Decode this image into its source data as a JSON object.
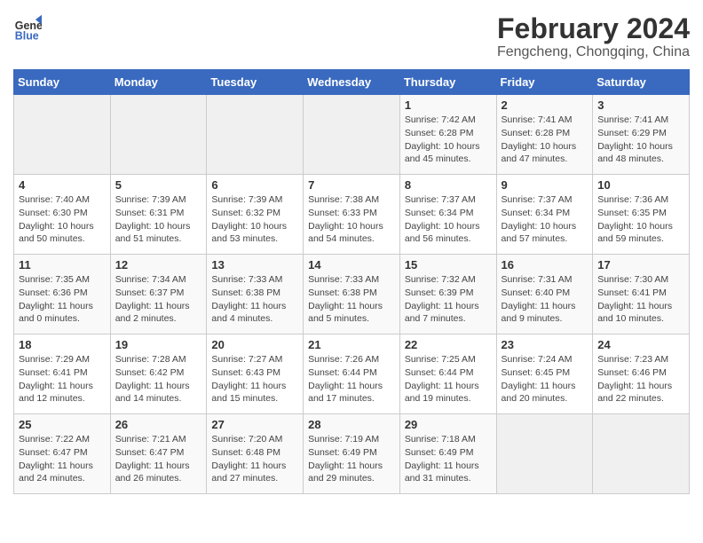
{
  "header": {
    "logo_line1": "General",
    "logo_line2": "Blue",
    "title": "February 2024",
    "subtitle": "Fengcheng, Chongqing, China"
  },
  "days_of_week": [
    "Sunday",
    "Monday",
    "Tuesday",
    "Wednesday",
    "Thursday",
    "Friday",
    "Saturday"
  ],
  "weeks": [
    [
      {
        "day": "",
        "info": ""
      },
      {
        "day": "",
        "info": ""
      },
      {
        "day": "",
        "info": ""
      },
      {
        "day": "",
        "info": ""
      },
      {
        "day": "1",
        "info": "Sunrise: 7:42 AM\nSunset: 6:28 PM\nDaylight: 10 hours\nand 45 minutes."
      },
      {
        "day": "2",
        "info": "Sunrise: 7:41 AM\nSunset: 6:28 PM\nDaylight: 10 hours\nand 47 minutes."
      },
      {
        "day": "3",
        "info": "Sunrise: 7:41 AM\nSunset: 6:29 PM\nDaylight: 10 hours\nand 48 minutes."
      }
    ],
    [
      {
        "day": "4",
        "info": "Sunrise: 7:40 AM\nSunset: 6:30 PM\nDaylight: 10 hours\nand 50 minutes."
      },
      {
        "day": "5",
        "info": "Sunrise: 7:39 AM\nSunset: 6:31 PM\nDaylight: 10 hours\nand 51 minutes."
      },
      {
        "day": "6",
        "info": "Sunrise: 7:39 AM\nSunset: 6:32 PM\nDaylight: 10 hours\nand 53 minutes."
      },
      {
        "day": "7",
        "info": "Sunrise: 7:38 AM\nSunset: 6:33 PM\nDaylight: 10 hours\nand 54 minutes."
      },
      {
        "day": "8",
        "info": "Sunrise: 7:37 AM\nSunset: 6:34 PM\nDaylight: 10 hours\nand 56 minutes."
      },
      {
        "day": "9",
        "info": "Sunrise: 7:37 AM\nSunset: 6:34 PM\nDaylight: 10 hours\nand 57 minutes."
      },
      {
        "day": "10",
        "info": "Sunrise: 7:36 AM\nSunset: 6:35 PM\nDaylight: 10 hours\nand 59 minutes."
      }
    ],
    [
      {
        "day": "11",
        "info": "Sunrise: 7:35 AM\nSunset: 6:36 PM\nDaylight: 11 hours\nand 0 minutes."
      },
      {
        "day": "12",
        "info": "Sunrise: 7:34 AM\nSunset: 6:37 PM\nDaylight: 11 hours\nand 2 minutes."
      },
      {
        "day": "13",
        "info": "Sunrise: 7:33 AM\nSunset: 6:38 PM\nDaylight: 11 hours\nand 4 minutes."
      },
      {
        "day": "14",
        "info": "Sunrise: 7:33 AM\nSunset: 6:38 PM\nDaylight: 11 hours\nand 5 minutes."
      },
      {
        "day": "15",
        "info": "Sunrise: 7:32 AM\nSunset: 6:39 PM\nDaylight: 11 hours\nand 7 minutes."
      },
      {
        "day": "16",
        "info": "Sunrise: 7:31 AM\nSunset: 6:40 PM\nDaylight: 11 hours\nand 9 minutes."
      },
      {
        "day": "17",
        "info": "Sunrise: 7:30 AM\nSunset: 6:41 PM\nDaylight: 11 hours\nand 10 minutes."
      }
    ],
    [
      {
        "day": "18",
        "info": "Sunrise: 7:29 AM\nSunset: 6:41 PM\nDaylight: 11 hours\nand 12 minutes."
      },
      {
        "day": "19",
        "info": "Sunrise: 7:28 AM\nSunset: 6:42 PM\nDaylight: 11 hours\nand 14 minutes."
      },
      {
        "day": "20",
        "info": "Sunrise: 7:27 AM\nSunset: 6:43 PM\nDaylight: 11 hours\nand 15 minutes."
      },
      {
        "day": "21",
        "info": "Sunrise: 7:26 AM\nSunset: 6:44 PM\nDaylight: 11 hours\nand 17 minutes."
      },
      {
        "day": "22",
        "info": "Sunrise: 7:25 AM\nSunset: 6:44 PM\nDaylight: 11 hours\nand 19 minutes."
      },
      {
        "day": "23",
        "info": "Sunrise: 7:24 AM\nSunset: 6:45 PM\nDaylight: 11 hours\nand 20 minutes."
      },
      {
        "day": "24",
        "info": "Sunrise: 7:23 AM\nSunset: 6:46 PM\nDaylight: 11 hours\nand 22 minutes."
      }
    ],
    [
      {
        "day": "25",
        "info": "Sunrise: 7:22 AM\nSunset: 6:47 PM\nDaylight: 11 hours\nand 24 minutes."
      },
      {
        "day": "26",
        "info": "Sunrise: 7:21 AM\nSunset: 6:47 PM\nDaylight: 11 hours\nand 26 minutes."
      },
      {
        "day": "27",
        "info": "Sunrise: 7:20 AM\nSunset: 6:48 PM\nDaylight: 11 hours\nand 27 minutes."
      },
      {
        "day": "28",
        "info": "Sunrise: 7:19 AM\nSunset: 6:49 PM\nDaylight: 11 hours\nand 29 minutes."
      },
      {
        "day": "29",
        "info": "Sunrise: 7:18 AM\nSunset: 6:49 PM\nDaylight: 11 hours\nand 31 minutes."
      },
      {
        "day": "",
        "info": ""
      },
      {
        "day": "",
        "info": ""
      }
    ]
  ]
}
